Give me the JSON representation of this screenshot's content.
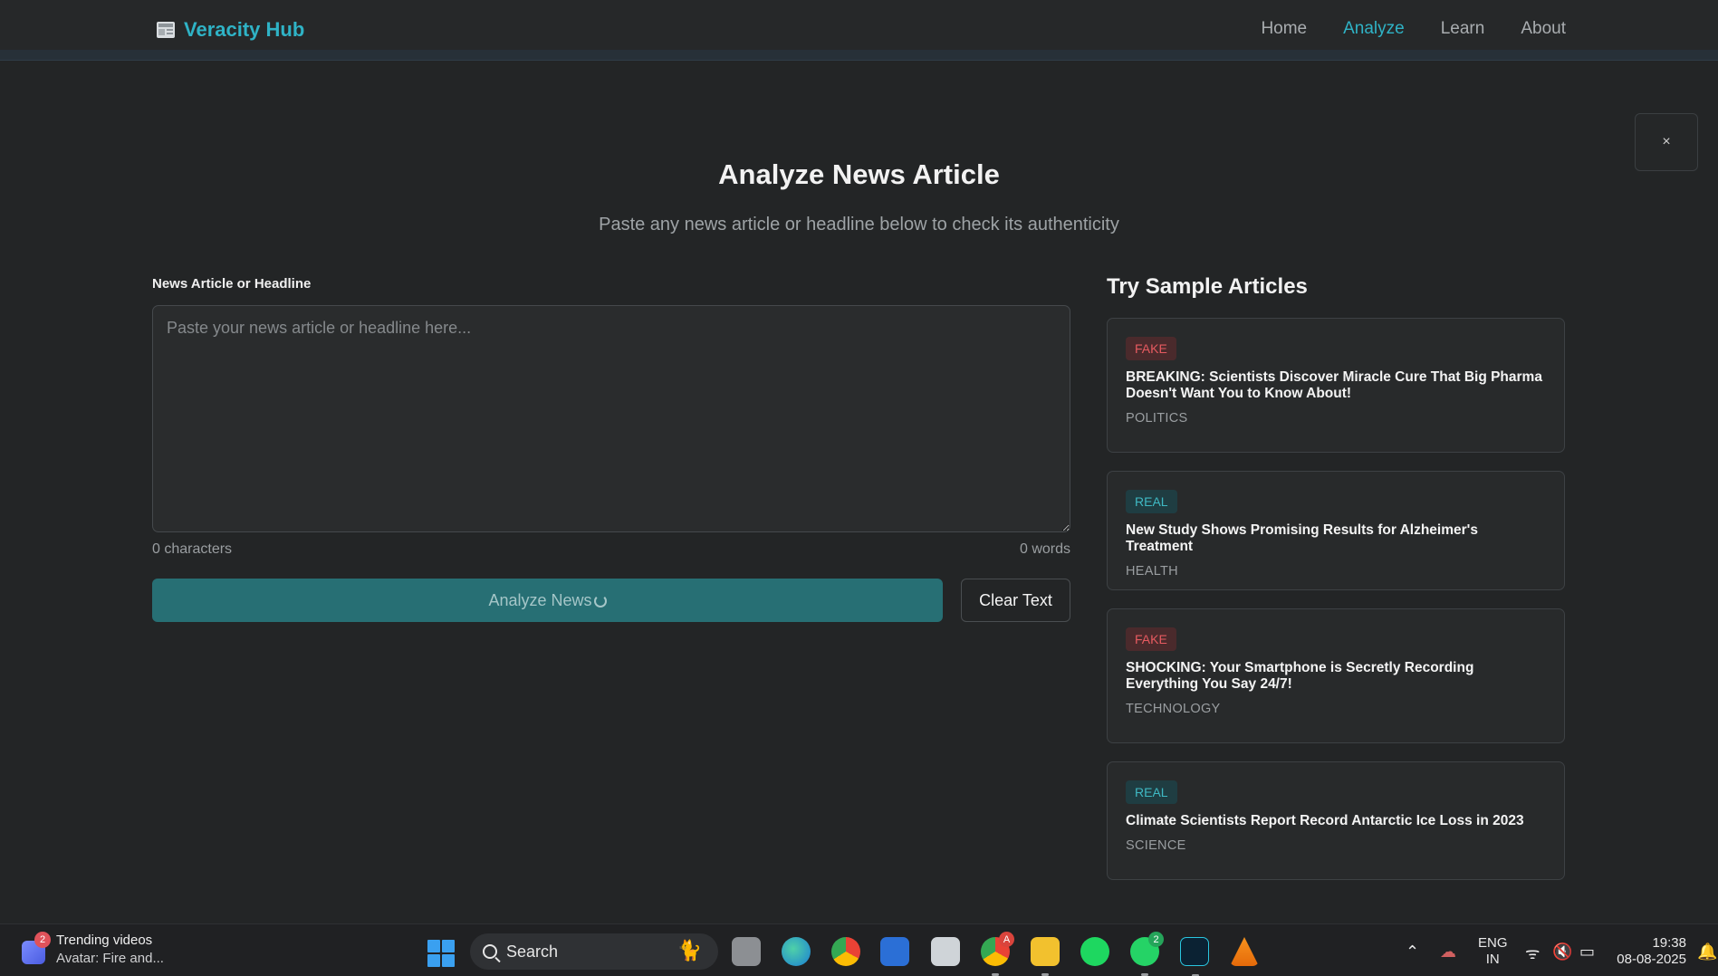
{
  "app": {
    "brand": "Veracity Hub",
    "accent": "#2fb3c6"
  },
  "nav": {
    "items": [
      {
        "label": "Home",
        "active": false
      },
      {
        "label": "Analyze",
        "active": true
      },
      {
        "label": "Learn",
        "active": false
      },
      {
        "label": "About",
        "active": false
      }
    ]
  },
  "close_button": {
    "label": "×"
  },
  "page": {
    "title": "Analyze News Article",
    "subtitle": "Paste any news article or headline below to check its authenticity"
  },
  "form": {
    "field_label": "News Article or Headline",
    "textarea_value": "",
    "textarea_placeholder": "Paste your news article or headline here...",
    "char_count": "0 characters",
    "word_count": "0 words",
    "analyze_label": "Analyze News",
    "clear_label": "Clear Text"
  },
  "samples": {
    "title": "Try Sample Articles",
    "items": [
      {
        "badge": "FAKE",
        "type": "fake",
        "title": "BREAKING: Scientists Discover Miracle Cure That Big Pharma Doesn't Want You to Know About!",
        "category": "POLITICS"
      },
      {
        "badge": "REAL",
        "type": "real",
        "title": "New Study Shows Promising Results for Alzheimer's Treatment",
        "category": "HEALTH"
      },
      {
        "badge": "FAKE",
        "type": "fake",
        "title": "SHOCKING: Your Smartphone is Secretly Recording Everything You Say 24/7!",
        "category": "TECHNOLOGY"
      },
      {
        "badge": "REAL",
        "type": "real",
        "title": "Climate Scientists Report Record Antarctic Ice Loss in 2023",
        "category": "SCIENCE"
      }
    ]
  },
  "taskbar": {
    "widget_title": "Trending videos",
    "widget_sub": "Avatar: Fire and...",
    "widget_badge": "2",
    "search_label": "Search",
    "chrome_badge": "A",
    "whatsapp_badge": "2",
    "lang_top": "ENG",
    "lang_bottom": "IN",
    "time": "19:38",
    "date": "08-08-2025"
  }
}
